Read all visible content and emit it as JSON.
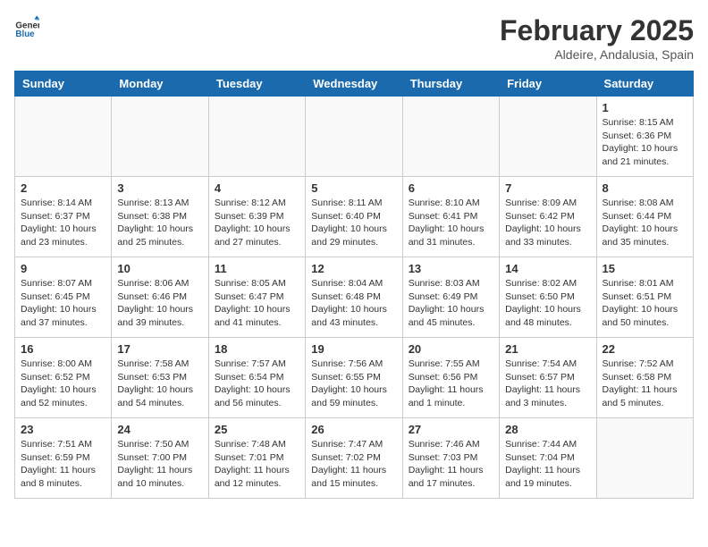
{
  "header": {
    "logo_general": "General",
    "logo_blue": "Blue",
    "main_title": "February 2025",
    "subtitle": "Aldeire, Andalusia, Spain"
  },
  "weekdays": [
    "Sunday",
    "Monday",
    "Tuesday",
    "Wednesday",
    "Thursday",
    "Friday",
    "Saturday"
  ],
  "weeks": [
    [
      {
        "day": "",
        "info": ""
      },
      {
        "day": "",
        "info": ""
      },
      {
        "day": "",
        "info": ""
      },
      {
        "day": "",
        "info": ""
      },
      {
        "day": "",
        "info": ""
      },
      {
        "day": "",
        "info": ""
      },
      {
        "day": "1",
        "info": "Sunrise: 8:15 AM\nSunset: 6:36 PM\nDaylight: 10 hours and 21 minutes."
      }
    ],
    [
      {
        "day": "2",
        "info": "Sunrise: 8:14 AM\nSunset: 6:37 PM\nDaylight: 10 hours and 23 minutes."
      },
      {
        "day": "3",
        "info": "Sunrise: 8:13 AM\nSunset: 6:38 PM\nDaylight: 10 hours and 25 minutes."
      },
      {
        "day": "4",
        "info": "Sunrise: 8:12 AM\nSunset: 6:39 PM\nDaylight: 10 hours and 27 minutes."
      },
      {
        "day": "5",
        "info": "Sunrise: 8:11 AM\nSunset: 6:40 PM\nDaylight: 10 hours and 29 minutes."
      },
      {
        "day": "6",
        "info": "Sunrise: 8:10 AM\nSunset: 6:41 PM\nDaylight: 10 hours and 31 minutes."
      },
      {
        "day": "7",
        "info": "Sunrise: 8:09 AM\nSunset: 6:42 PM\nDaylight: 10 hours and 33 minutes."
      },
      {
        "day": "8",
        "info": "Sunrise: 8:08 AM\nSunset: 6:44 PM\nDaylight: 10 hours and 35 minutes."
      }
    ],
    [
      {
        "day": "9",
        "info": "Sunrise: 8:07 AM\nSunset: 6:45 PM\nDaylight: 10 hours and 37 minutes."
      },
      {
        "day": "10",
        "info": "Sunrise: 8:06 AM\nSunset: 6:46 PM\nDaylight: 10 hours and 39 minutes."
      },
      {
        "day": "11",
        "info": "Sunrise: 8:05 AM\nSunset: 6:47 PM\nDaylight: 10 hours and 41 minutes."
      },
      {
        "day": "12",
        "info": "Sunrise: 8:04 AM\nSunset: 6:48 PM\nDaylight: 10 hours and 43 minutes."
      },
      {
        "day": "13",
        "info": "Sunrise: 8:03 AM\nSunset: 6:49 PM\nDaylight: 10 hours and 45 minutes."
      },
      {
        "day": "14",
        "info": "Sunrise: 8:02 AM\nSunset: 6:50 PM\nDaylight: 10 hours and 48 minutes."
      },
      {
        "day": "15",
        "info": "Sunrise: 8:01 AM\nSunset: 6:51 PM\nDaylight: 10 hours and 50 minutes."
      }
    ],
    [
      {
        "day": "16",
        "info": "Sunrise: 8:00 AM\nSunset: 6:52 PM\nDaylight: 10 hours and 52 minutes."
      },
      {
        "day": "17",
        "info": "Sunrise: 7:58 AM\nSunset: 6:53 PM\nDaylight: 10 hours and 54 minutes."
      },
      {
        "day": "18",
        "info": "Sunrise: 7:57 AM\nSunset: 6:54 PM\nDaylight: 10 hours and 56 minutes."
      },
      {
        "day": "19",
        "info": "Sunrise: 7:56 AM\nSunset: 6:55 PM\nDaylight: 10 hours and 59 minutes."
      },
      {
        "day": "20",
        "info": "Sunrise: 7:55 AM\nSunset: 6:56 PM\nDaylight: 11 hours and 1 minute."
      },
      {
        "day": "21",
        "info": "Sunrise: 7:54 AM\nSunset: 6:57 PM\nDaylight: 11 hours and 3 minutes."
      },
      {
        "day": "22",
        "info": "Sunrise: 7:52 AM\nSunset: 6:58 PM\nDaylight: 11 hours and 5 minutes."
      }
    ],
    [
      {
        "day": "23",
        "info": "Sunrise: 7:51 AM\nSunset: 6:59 PM\nDaylight: 11 hours and 8 minutes."
      },
      {
        "day": "24",
        "info": "Sunrise: 7:50 AM\nSunset: 7:00 PM\nDaylight: 11 hours and 10 minutes."
      },
      {
        "day": "25",
        "info": "Sunrise: 7:48 AM\nSunset: 7:01 PM\nDaylight: 11 hours and 12 minutes."
      },
      {
        "day": "26",
        "info": "Sunrise: 7:47 AM\nSunset: 7:02 PM\nDaylight: 11 hours and 15 minutes."
      },
      {
        "day": "27",
        "info": "Sunrise: 7:46 AM\nSunset: 7:03 PM\nDaylight: 11 hours and 17 minutes."
      },
      {
        "day": "28",
        "info": "Sunrise: 7:44 AM\nSunset: 7:04 PM\nDaylight: 11 hours and 19 minutes."
      },
      {
        "day": "",
        "info": ""
      }
    ]
  ]
}
